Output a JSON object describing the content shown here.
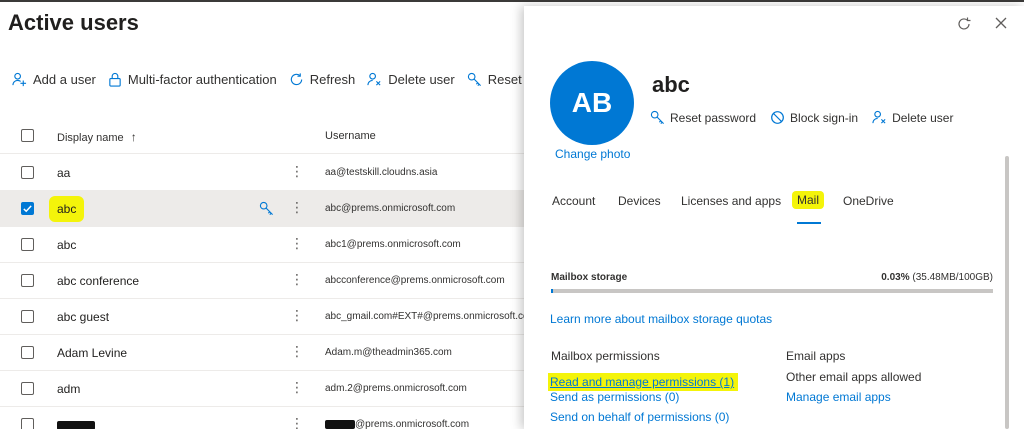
{
  "page_title": "Active users",
  "toolbar": {
    "add_user": "Add a user",
    "mfa": "Multi-factor authentication",
    "refresh": "Refresh",
    "delete_user": "Delete user",
    "reset_password": "Reset passw"
  },
  "table": {
    "col_display_name": "Display name",
    "col_username": "Username",
    "sort_indicator": "↑",
    "more_glyph": "⋮",
    "rows": [
      {
        "name": "aa",
        "username": "aa@testskill.cloudns.asia"
      },
      {
        "name": "abc",
        "username": "abc@prems.onmicrosoft.com",
        "selected": true
      },
      {
        "name": "abc",
        "username": "abc1@prems.onmicrosoft.com"
      },
      {
        "name": "abc conference",
        "username": "abcconference@prems.onmicrosoft.com"
      },
      {
        "name": "abc guest",
        "username": "abc_gmail.com#EXT#@prems.onmicrosoft.co"
      },
      {
        "name": "Adam Levine",
        "username": "Adam.m@theadmin365.com"
      },
      {
        "name": "adm",
        "username": "adm.2@prems.onmicrosoft.com"
      },
      {
        "name": "",
        "username": "@prems.onmicrosoft.com",
        "redacted": true
      }
    ]
  },
  "panel": {
    "avatar_initials": "AB",
    "user_name": "abc",
    "change_photo": "Change photo",
    "actions": {
      "reset_password": "Reset password",
      "block_signin": "Block sign-in",
      "delete_user": "Delete user"
    },
    "tabs": [
      "Account",
      "Devices",
      "Licenses and apps",
      "Mail",
      "OneDrive"
    ],
    "active_tab": "Mail",
    "mailbox": {
      "storage_label": "Mailbox storage",
      "storage_percent": "0.03%",
      "storage_detail": "(35.48MB/100GB)",
      "storage_fraction": 0.003,
      "learn_more": "Learn more about mailbox storage quotas"
    },
    "permissions": {
      "heading": "Mailbox permissions",
      "read_manage": "Read and manage permissions (1)",
      "send_as": "Send as permissions (0)",
      "send_on_behalf": "Send on behalf of permissions (0)"
    },
    "email_apps": {
      "heading": "Email apps",
      "status": "Other email apps allowed",
      "manage": "Manage email apps"
    }
  },
  "colors": {
    "accent": "#0078d4",
    "highlight": "#f4f40a",
    "selected_row": "#edebe9"
  }
}
